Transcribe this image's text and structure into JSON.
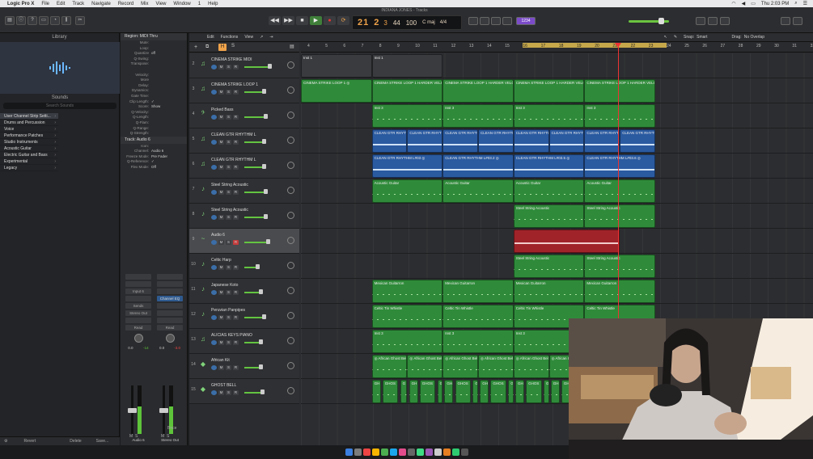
{
  "menubar": {
    "app": "Logic Pro X",
    "items": [
      "File",
      "Edit",
      "Track",
      "Navigate",
      "Record",
      "Mix",
      "View",
      "Window",
      "1",
      "Help"
    ],
    "clock": "Thu 2:03 PM"
  },
  "window": {
    "title": "INDIANA JONES - Tracks"
  },
  "lcd": {
    "bar": "21",
    "beat": "2",
    "div": "3",
    "tempo": "44",
    "bpm": "100",
    "key": "C maj",
    "sig": "4/4"
  },
  "toolbar": {
    "count_label": "1234"
  },
  "library": {
    "title": "Library",
    "sounds_label": "Sounds",
    "search_placeholder": "Search Sounds",
    "categories": [
      "User Channel Strip Setti...",
      "Drums and Percussion",
      "Voice",
      "Performance Patches",
      "Studio Instruments",
      "Acoustic Guitar",
      "Electric Guitar and Bass",
      "Experimental",
      "Legacy"
    ],
    "revert": "Revert",
    "delete": "Delete",
    "save": "Save..."
  },
  "inspector": {
    "region_header": "Region: MIDI Thru",
    "region_rows": [
      [
        "Mute:",
        ""
      ],
      [
        "Loop:",
        ""
      ],
      [
        "Quantize",
        "off"
      ],
      [
        "Q-Swing:",
        ""
      ],
      [
        "Transpose:",
        ""
      ],
      [
        "",
        ""
      ],
      [
        "Velocity:",
        ""
      ],
      [
        "More",
        ""
      ],
      [
        "Delay:",
        ""
      ],
      [
        "Dynamics:",
        ""
      ],
      [
        "Gate Time:",
        ""
      ],
      [
        "Clip Length:",
        "✓"
      ],
      [
        "Score:",
        "Show"
      ],
      [
        "Q-Velocity:",
        ""
      ],
      [
        "Q-Length:",
        ""
      ],
      [
        "Q-Flam:",
        ""
      ],
      [
        "Q-Range:",
        ""
      ],
      [
        "Q-Strength:",
        ""
      ]
    ],
    "track_header": "Track: Audio 6",
    "track_rows": [
      [
        "Icon:",
        ""
      ],
      [
        "Channel:",
        "Audio 6"
      ],
      [
        "Freeze Mode:",
        "Pre Fader"
      ],
      [
        "Q-Reference:",
        "✓"
      ],
      [
        "Flex Mode:",
        "Off"
      ]
    ],
    "strip1": {
      "name": "Audio 6",
      "input": "Input 6",
      "eq": "",
      "send": "Sends",
      "out": "Stereo Out",
      "auto": "Read",
      "val1": "0.0",
      "val2": "-14"
    },
    "strip2": {
      "name": "Stereo Out",
      "eq": "Channel EQ",
      "auto": "Read",
      "val1": "0.0",
      "val2": "-3.0",
      "bnce": "Bnce"
    }
  },
  "main": {
    "edit": "Edit",
    "functions": "Functions",
    "view": "View",
    "snap_label": "Snap:",
    "snap_value": "Smart",
    "drag_label": "Drag:",
    "drag_value": "No Overlap"
  },
  "ruler": {
    "bars": [
      "4",
      "5",
      "6",
      "7",
      "8",
      "9",
      "10",
      "11",
      "12",
      "13",
      "14",
      "15",
      "16",
      "17",
      "18",
      "19",
      "20",
      "21",
      "22",
      "23",
      "24",
      "25",
      "26",
      "27",
      "28",
      "29",
      "30",
      "31",
      "32",
      "33"
    ]
  },
  "tracks": [
    {
      "num": "2",
      "name": "CINEMA STRIKE MIDI",
      "icon": "♫",
      "r_on": false,
      "vol": 0.72
    },
    {
      "num": "3",
      "name": "CINEMA STRIKE LOOP 1",
      "icon": "♫",
      "r_on": false,
      "vol": 0.55
    },
    {
      "num": "4",
      "name": "Picked Bass",
      "icon": "𝄢",
      "r_on": false,
      "vol": 0.6
    },
    {
      "num": "5",
      "name": "CLEAN GTR RHYTHM L",
      "icon": "♫",
      "r_on": false,
      "vol": 0.55
    },
    {
      "num": "6",
      "name": "CLEAN GTR RHYTHM L",
      "icon": "♫",
      "r_on": false,
      "vol": 0.55
    },
    {
      "num": "7",
      "name": "Steel String Acoustic",
      "icon": "♪",
      "r_on": false,
      "vol": 0.6
    },
    {
      "num": "8",
      "name": "Steel String Acoustic",
      "icon": "♪",
      "r_on": false,
      "vol": 0.6
    },
    {
      "num": "9",
      "name": "Audio 6",
      "icon": "~",
      "r_on": true,
      "vol": 0.68
    },
    {
      "num": "10",
      "name": "Celtic Harp",
      "icon": "♪",
      "r_on": false,
      "vol": 0.35
    },
    {
      "num": "11",
      "name": "Japanese Koto",
      "icon": "♪",
      "r_on": false,
      "vol": 0.45
    },
    {
      "num": "12",
      "name": "Peruvian Panpipes",
      "icon": "♪",
      "r_on": false,
      "vol": 0.55
    },
    {
      "num": "13",
      "name": "ALICIAS KEYS PIANO",
      "icon": "♫",
      "r_on": false,
      "vol": 0.45
    },
    {
      "num": "14",
      "name": "African Kit",
      "icon": "◆",
      "r_on": false,
      "vol": 0.45
    },
    {
      "num": "15",
      "name": "GHOST BELL",
      "icon": "◆",
      "r_on": false,
      "vol": 0.5
    }
  ],
  "regions": [
    [
      {
        "s": 0,
        "e": 4,
        "c": "gray",
        "n": "Inst 1"
      },
      {
        "s": 4,
        "e": 8,
        "c": "gray",
        "n": "Inst 1"
      }
    ],
    [
      {
        "s": 0,
        "e": 4,
        "c": "green",
        "n": "CINEMA STRIKE LOOP 1  ◎"
      },
      {
        "s": 4,
        "e": 8,
        "c": "green",
        "n": "CINEMA STRIKE LOOP 1 HARDER VELOC"
      },
      {
        "s": 8,
        "e": 12,
        "c": "green",
        "n": "CINEMA STRIKE LOOP 1 HARDER VELOC"
      },
      {
        "s": 12,
        "e": 16,
        "c": "green",
        "n": "CINEMA STRIKE LOOP 1 HARDER VELOC"
      },
      {
        "s": 16,
        "e": 20,
        "c": "green",
        "n": "CINEMA STRIKE LOOP 1 HARDER VELOC"
      }
    ],
    [
      {
        "s": 4,
        "e": 8,
        "c": "midi",
        "n": "Inst 3"
      },
      {
        "s": 8,
        "e": 12,
        "c": "midi",
        "n": "Inst 3"
      },
      {
        "s": 12,
        "e": 16,
        "c": "midi",
        "n": "Inst 3"
      },
      {
        "s": 16,
        "e": 20,
        "c": "midi",
        "n": "Inst 3"
      }
    ],
    [
      {
        "s": 4,
        "e": 6,
        "c": "blue",
        "n": "CLEAN GTR RHYTH"
      },
      {
        "s": 6,
        "e": 8,
        "c": "blue",
        "n": "CLEAN GTR RHYTH"
      },
      {
        "s": 8,
        "e": 10,
        "c": "blue",
        "n": "CLEAN GTR RHYTH"
      },
      {
        "s": 10,
        "e": 12,
        "c": "blue",
        "n": "CLEAN GTR RHYTH"
      },
      {
        "s": 12,
        "e": 14,
        "c": "blue",
        "n": "CLEAN GTR RHYTH"
      },
      {
        "s": 14,
        "e": 16,
        "c": "blue",
        "n": "CLEAN GTR RHYTH"
      },
      {
        "s": 16,
        "e": 18,
        "c": "blue",
        "n": "CLEAN GTR RHYTH"
      },
      {
        "s": 18,
        "e": 20,
        "c": "blue",
        "n": "CLEAN GTR RHYTH"
      }
    ],
    [
      {
        "s": 4,
        "e": 8,
        "c": "blue",
        "n": "CLEAN GTR RHYTHM L#03  ◎"
      },
      {
        "s": 8,
        "e": 12,
        "c": "blue",
        "n": "CLEAN GTR RHYTHM L#03.2  ◎"
      },
      {
        "s": 12,
        "e": 16,
        "c": "blue",
        "n": "CLEAN GTR RHYTHM L#03.5  ◎"
      },
      {
        "s": 16,
        "e": 20,
        "c": "blue",
        "n": "CLEAN GTR RHYTHM L#03.6  ◎"
      }
    ],
    [
      {
        "s": 4,
        "e": 8,
        "c": "midi",
        "n": "Acoustic Guitar"
      },
      {
        "s": 8,
        "e": 12,
        "c": "midi",
        "n": "Acoustic Guitar"
      },
      {
        "s": 12,
        "e": 16,
        "c": "midi",
        "n": "Acoustic Guitar"
      },
      {
        "s": 16,
        "e": 20,
        "c": "midi",
        "n": "Acoustic Guitar"
      }
    ],
    [
      {
        "s": 12,
        "e": 16,
        "c": "midi",
        "n": "Steel String Acoustic"
      },
      {
        "s": 16,
        "e": 20,
        "c": "midi",
        "n": "Steel String Acoustic"
      }
    ],
    [
      {
        "s": 12,
        "e": 18,
        "c": "red",
        "n": ""
      }
    ],
    [
      {
        "s": 12,
        "e": 16,
        "c": "midi",
        "n": "Steel String Acoustic"
      },
      {
        "s": 16,
        "e": 20,
        "c": "midi",
        "n": "Steel String Acoustic"
      }
    ],
    [
      {
        "s": 4,
        "e": 8,
        "c": "midi",
        "n": "Mexican Guitarron"
      },
      {
        "s": 8,
        "e": 12,
        "c": "midi",
        "n": "Mexican Guitarron"
      },
      {
        "s": 12,
        "e": 16,
        "c": "midi",
        "n": "Mexican Guitarron"
      },
      {
        "s": 16,
        "e": 20,
        "c": "midi",
        "n": "Mexican Guitarron"
      }
    ],
    [
      {
        "s": 4,
        "e": 8,
        "c": "midi",
        "n": "Celtic Tin Whistle"
      },
      {
        "s": 8,
        "e": 12,
        "c": "midi",
        "n": "Celtic Tin Whistle"
      },
      {
        "s": 12,
        "e": 16,
        "c": "midi",
        "n": "Celtic Tin Whistle"
      },
      {
        "s": 16,
        "e": 20,
        "c": "midi",
        "n": "Celtic Tin Whistle"
      }
    ],
    [
      {
        "s": 4,
        "e": 8,
        "c": "midi",
        "n": "Inst 3"
      },
      {
        "s": 8,
        "e": 12,
        "c": "midi",
        "n": "Inst 3"
      },
      {
        "s": 12,
        "e": 16,
        "c": "midi",
        "n": "Inst 3"
      },
      {
        "s": 16,
        "e": 20,
        "c": "midi",
        "n": "Inst 3"
      }
    ],
    [
      {
        "s": 4,
        "e": 6,
        "c": "midi",
        "n": "◎ African Ghost Bell"
      },
      {
        "s": 6,
        "e": 8,
        "c": "midi",
        "n": "◎ African Ghost Bell"
      },
      {
        "s": 8,
        "e": 10,
        "c": "midi",
        "n": "◎ African Ghost Bell"
      },
      {
        "s": 10,
        "e": 12,
        "c": "midi",
        "n": "◎ African Ghost Bell"
      },
      {
        "s": 12,
        "e": 14,
        "c": "midi",
        "n": "◎ African Ghost Bell"
      },
      {
        "s": 14,
        "e": 16,
        "c": "midi",
        "n": "◎ African Ghost Bell"
      },
      {
        "s": 16,
        "e": 18,
        "c": "midi",
        "n": "◎ African Ghost Bell"
      },
      {
        "s": 18,
        "e": 20,
        "c": "midi",
        "n": "◎ African Ghost Bell"
      }
    ],
    [
      {
        "s": 4,
        "e": 4.5,
        "c": "midi",
        "n": "GH"
      },
      {
        "s": 4.6,
        "e": 5.5,
        "c": "midi",
        "n": "GHOS"
      },
      {
        "s": 5.6,
        "e": 6,
        "c": "midi",
        "n": "G"
      },
      {
        "s": 6.1,
        "e": 6.6,
        "c": "midi",
        "n": "GH"
      },
      {
        "s": 6.7,
        "e": 7.6,
        "c": "midi",
        "n": "GHOS"
      },
      {
        "s": 7.7,
        "e": 8,
        "c": "midi",
        "n": "G"
      },
      {
        "s": 8.1,
        "e": 8.6,
        "c": "midi",
        "n": "GH"
      },
      {
        "s": 8.7,
        "e": 9.6,
        "c": "midi",
        "n": "GHOS"
      },
      {
        "s": 9.7,
        "e": 10,
        "c": "midi",
        "n": "G"
      },
      {
        "s": 10.1,
        "e": 10.6,
        "c": "midi",
        "n": "GH"
      },
      {
        "s": 10.7,
        "e": 11.6,
        "c": "midi",
        "n": "GHOS"
      },
      {
        "s": 11.7,
        "e": 12,
        "c": "midi",
        "n": "G"
      },
      {
        "s": 12.1,
        "e": 12.6,
        "c": "midi",
        "n": "GH"
      },
      {
        "s": 12.7,
        "e": 13.6,
        "c": "midi",
        "n": "GHOS"
      },
      {
        "s": 13.7,
        "e": 14,
        "c": "midi",
        "n": "G"
      },
      {
        "s": 14.1,
        "e": 14.6,
        "c": "midi",
        "n": "GH"
      },
      {
        "s": 14.7,
        "e": 15.6,
        "c": "midi",
        "n": "GHOS"
      },
      {
        "s": 15.7,
        "e": 16,
        "c": "midi",
        "n": "G"
      },
      {
        "s": 16.1,
        "e": 16.6,
        "c": "midi",
        "n": "GH"
      },
      {
        "s": 16.7,
        "e": 17.6,
        "c": "midi",
        "n": "GHOS"
      },
      {
        "s": 17.7,
        "e": 18,
        "c": "midi",
        "n": "G"
      },
      {
        "s": 18.1,
        "e": 18.6,
        "c": "midi",
        "n": "GH"
      },
      {
        "s": 18.7,
        "e": 20,
        "c": "midi",
        "n": "GHOS"
      }
    ]
  ],
  "playhead_bar": 21.3,
  "cycle": {
    "start": 16,
    "end": 24
  },
  "colors": {
    "region_green": "#2f8b3a",
    "region_blue": "#2a5aa0",
    "region_red": "#a0232a",
    "accent_orange": "#f0a34a",
    "cycle": "#c6a84b",
    "playhead": "#ee3333"
  }
}
